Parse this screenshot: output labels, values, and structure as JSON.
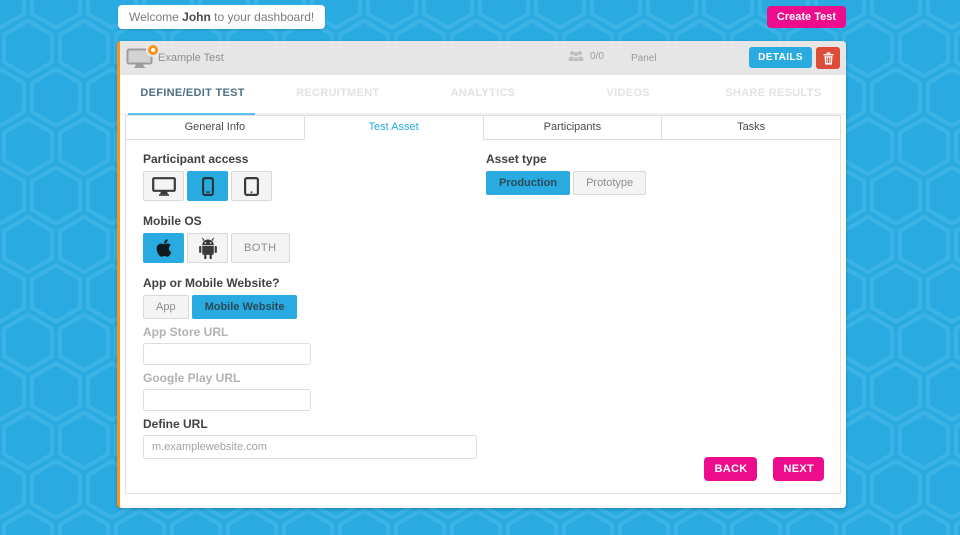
{
  "colors": {
    "background_cyan": "#29abe2",
    "accent_magenta": "#ec0c8c",
    "accent_orange": "#f7941e",
    "delete_red": "#dd4b39",
    "active_tab_underline": "#55c4f2"
  },
  "icons": {
    "test": "monitor-icon",
    "badge": "notification-badge",
    "participants": "people-icon",
    "delete": "trash-icon",
    "desktop": "desktop-icon",
    "mobile": "smartphone-icon",
    "tablet": "tablet-icon",
    "ios": "apple-icon",
    "android": "android-icon"
  },
  "topbar": {
    "welcome_prefix": "Welcome ",
    "welcome_name": "John",
    "welcome_suffix": " to your dashboard!",
    "create_test_label": "Create Test"
  },
  "test_card": {
    "title": "Example Test",
    "participants_count": "0/0",
    "panel_label": "Panel",
    "details_label": "DETAILS"
  },
  "main_tabs": [
    {
      "label": "DEFINE/EDIT TEST",
      "active": true
    },
    {
      "label": "RECRUITMENT",
      "active": false
    },
    {
      "label": "ANALYTICS",
      "active": false
    },
    {
      "label": "VIDEOS",
      "active": false
    },
    {
      "label": "SHARE RESULTS",
      "active": false
    }
  ],
  "sub_tabs": [
    {
      "label": "General Info",
      "active": false
    },
    {
      "label": "Test Asset",
      "active": true
    },
    {
      "label": "Participants",
      "active": false
    },
    {
      "label": "Tasks",
      "active": false
    }
  ],
  "form": {
    "participant_access": {
      "label": "Participant access",
      "options": [
        "desktop",
        "mobile",
        "tablet"
      ],
      "selected": "mobile"
    },
    "asset_type": {
      "label": "Asset type",
      "options": [
        "Production",
        "Prototype"
      ],
      "selected": "Production"
    },
    "mobile_os": {
      "label": "Mobile OS",
      "options": [
        "apple",
        "android",
        "BOTH"
      ],
      "selected": "apple",
      "both_label": "BOTH"
    },
    "app_or_web": {
      "label": "App or Mobile Website?",
      "options": [
        "App",
        "Mobile Website"
      ],
      "selected": "Mobile Website"
    },
    "app_store_url": {
      "label": "App Store URL",
      "value": ""
    },
    "google_play_url": {
      "label": "Google Play URL",
      "value": ""
    },
    "define_url": {
      "label": "Define URL",
      "value": "",
      "placeholder": "m.examplewebsite.com"
    }
  },
  "footer": {
    "back_label": "BACK",
    "next_label": "NEXT"
  }
}
